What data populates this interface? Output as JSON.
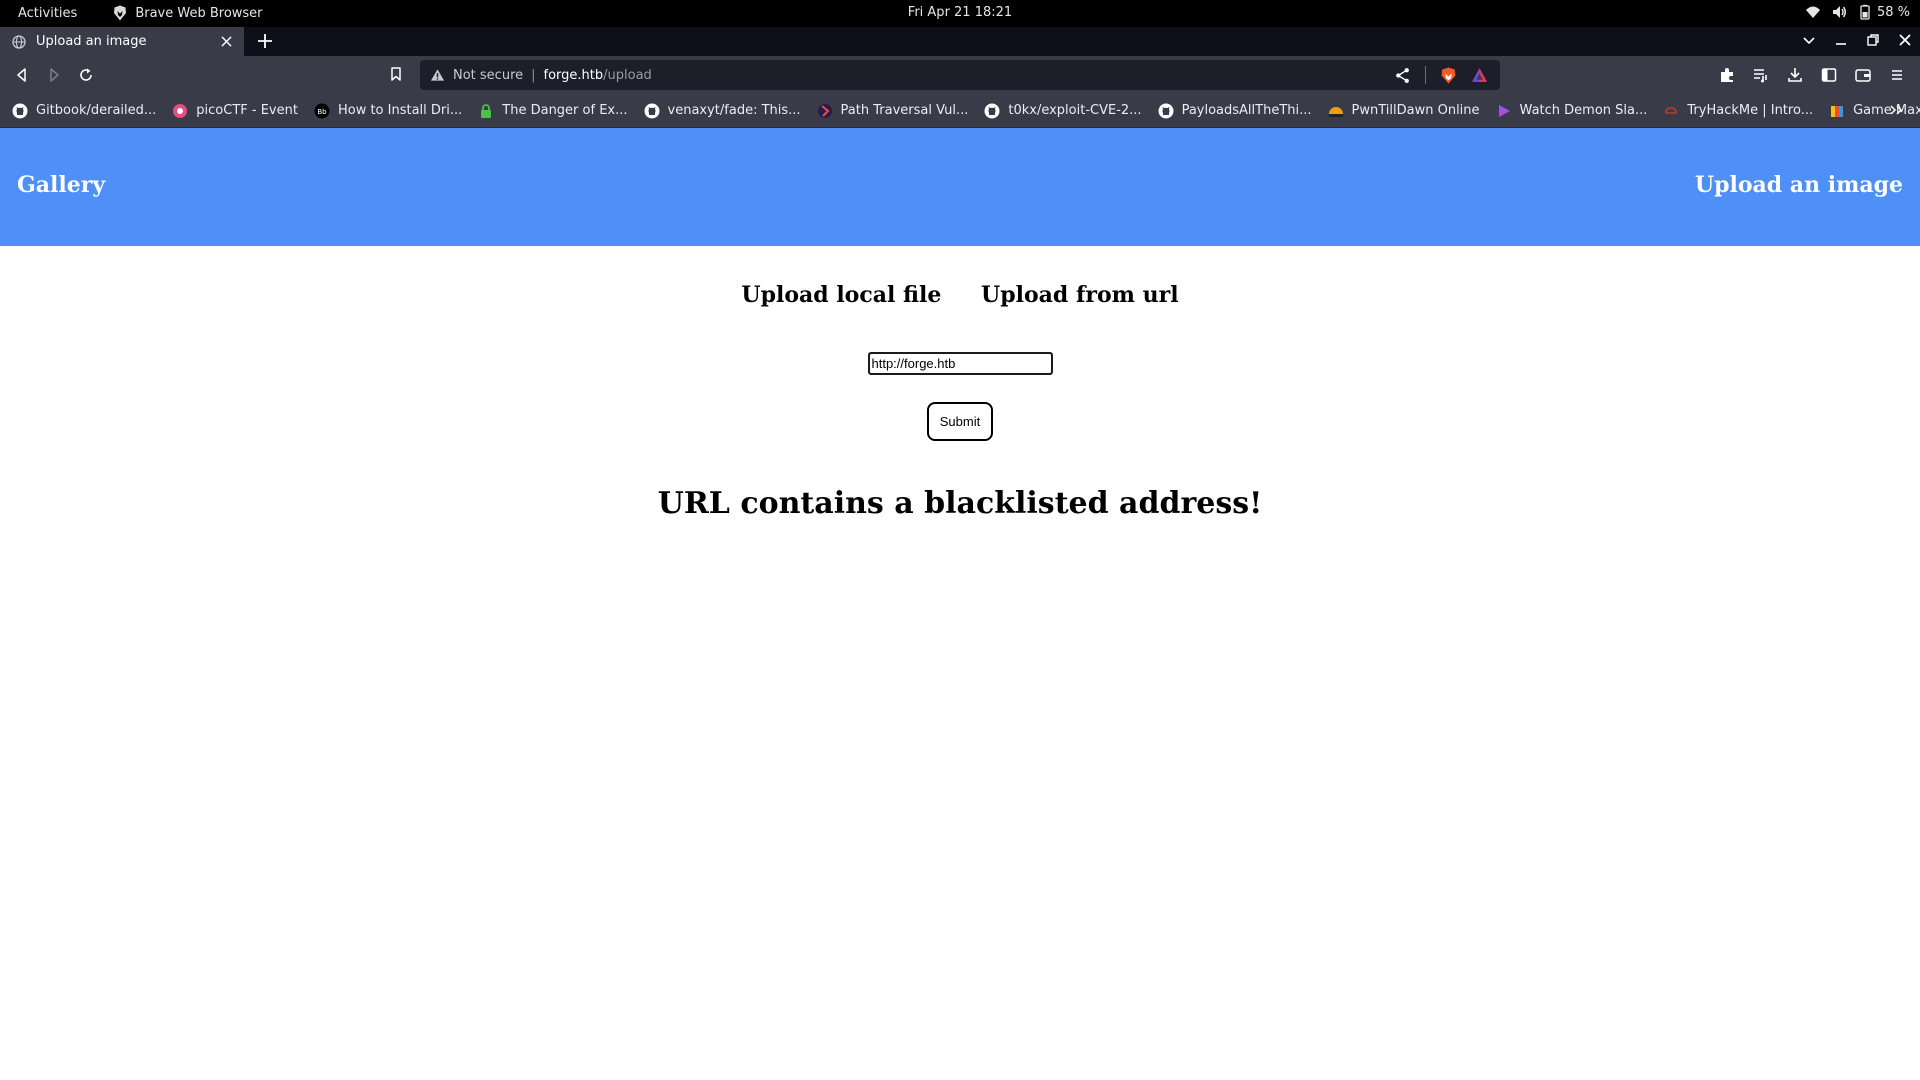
{
  "system_bar": {
    "activities": "Activities",
    "app_name": "Brave Web Browser",
    "clock": "Fri Apr 21  18:21",
    "battery": "58 %"
  },
  "browser": {
    "tab": {
      "title": "Upload an image"
    },
    "urlbar": {
      "security": "Not secure",
      "host": "forge.htb",
      "path": "/upload"
    },
    "bookmarks": [
      {
        "label": "Gitbook/derailed...",
        "icon": "github-icon"
      },
      {
        "label": "picoCTF - Event",
        "icon": "picoctf-icon"
      },
      {
        "label": "How to Install Dri...",
        "icon": "site-icon"
      },
      {
        "label": "The Danger of Ex...",
        "icon": "lock-icon"
      },
      {
        "label": "venaxyt/fade: This...",
        "icon": "github-icon"
      },
      {
        "label": "Path Traversal Vul...",
        "icon": "portswigger-icon"
      },
      {
        "label": "t0kx/exploit-CVE-2...",
        "icon": "github-icon"
      },
      {
        "label": "PayloadsAllTheThi...",
        "icon": "github-icon"
      },
      {
        "label": "PwnTillDawn Online",
        "icon": "pwntilldawn-icon"
      },
      {
        "label": "Watch Demon Sla...",
        "icon": "play-icon"
      },
      {
        "label": "TryHackMe | Intro...",
        "icon": "tryhackme-icon"
      },
      {
        "label": "Game Max Comm...",
        "icon": "gamemax-icon"
      }
    ]
  },
  "page": {
    "header": {
      "gallery": "Gallery",
      "upload": "Upload an image"
    },
    "options": {
      "local": "Upload local file",
      "url": "Upload from url"
    },
    "form": {
      "url_value": "http://forge.htb",
      "submit": "Submit"
    },
    "error": "URL contains a blacklisted address!"
  },
  "colors": {
    "header_bg": "#4f8ff8",
    "browser_chrome": "#3a3b49",
    "urlbar_bg": "#1d1e2a"
  }
}
